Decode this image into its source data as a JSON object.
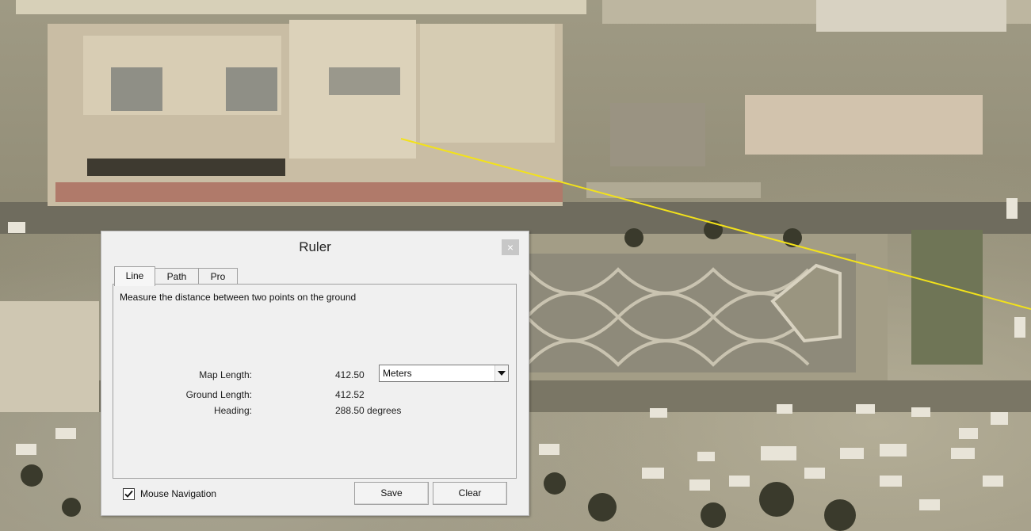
{
  "dialog": {
    "title": "Ruler",
    "close_glyph": "×",
    "tabs": [
      {
        "label": "Line",
        "active": true
      },
      {
        "label": "Path",
        "active": false
      },
      {
        "label": "Pro",
        "active": false
      }
    ],
    "description": "Measure the distance between two points on the ground",
    "map_length": {
      "label": "Map Length:",
      "value": "412.50"
    },
    "units": {
      "selected": "Meters"
    },
    "ground_length": {
      "label": "Ground Length:",
      "value": "412.52"
    },
    "heading": {
      "label": "Heading:",
      "value": "288.50 degrees"
    },
    "mouse_navigation": {
      "label": "Mouse Navigation",
      "checked": true
    },
    "buttons": {
      "save": "Save",
      "clear": "Clear"
    }
  },
  "measurement_line_color": "#f3e21a",
  "icons": {
    "dropdown": "chevron-down-icon",
    "checkmark": "checkmark-icon",
    "close": "close-icon"
  }
}
